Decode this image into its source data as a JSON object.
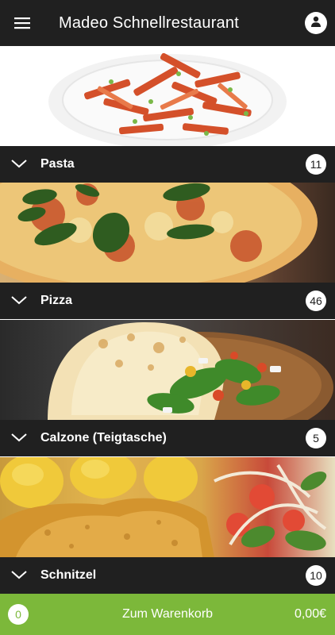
{
  "appbar": {
    "title": "Madeo Schnellrestaurant",
    "menu_icon": "hamburger-menu-icon",
    "account_icon": "user-icon"
  },
  "categories": [
    {
      "label": "Pasta",
      "count": "11",
      "image": "penne-pasta-plate"
    },
    {
      "label": "Pizza",
      "count": "46",
      "image": "margherita-pizza"
    },
    {
      "label": "Calzone (Teigtasche)",
      "count": "5",
      "image": "calzone-with-salad"
    },
    {
      "label": "Schnitzel",
      "count": "10",
      "image": "schnitzel-with-potatoes-and-salad"
    }
  ],
  "cart": {
    "count": "0",
    "label": "Zum Warenkorb",
    "total": "0,00€"
  },
  "colors": {
    "bar": "#202020",
    "accent": "#7cb83a"
  }
}
